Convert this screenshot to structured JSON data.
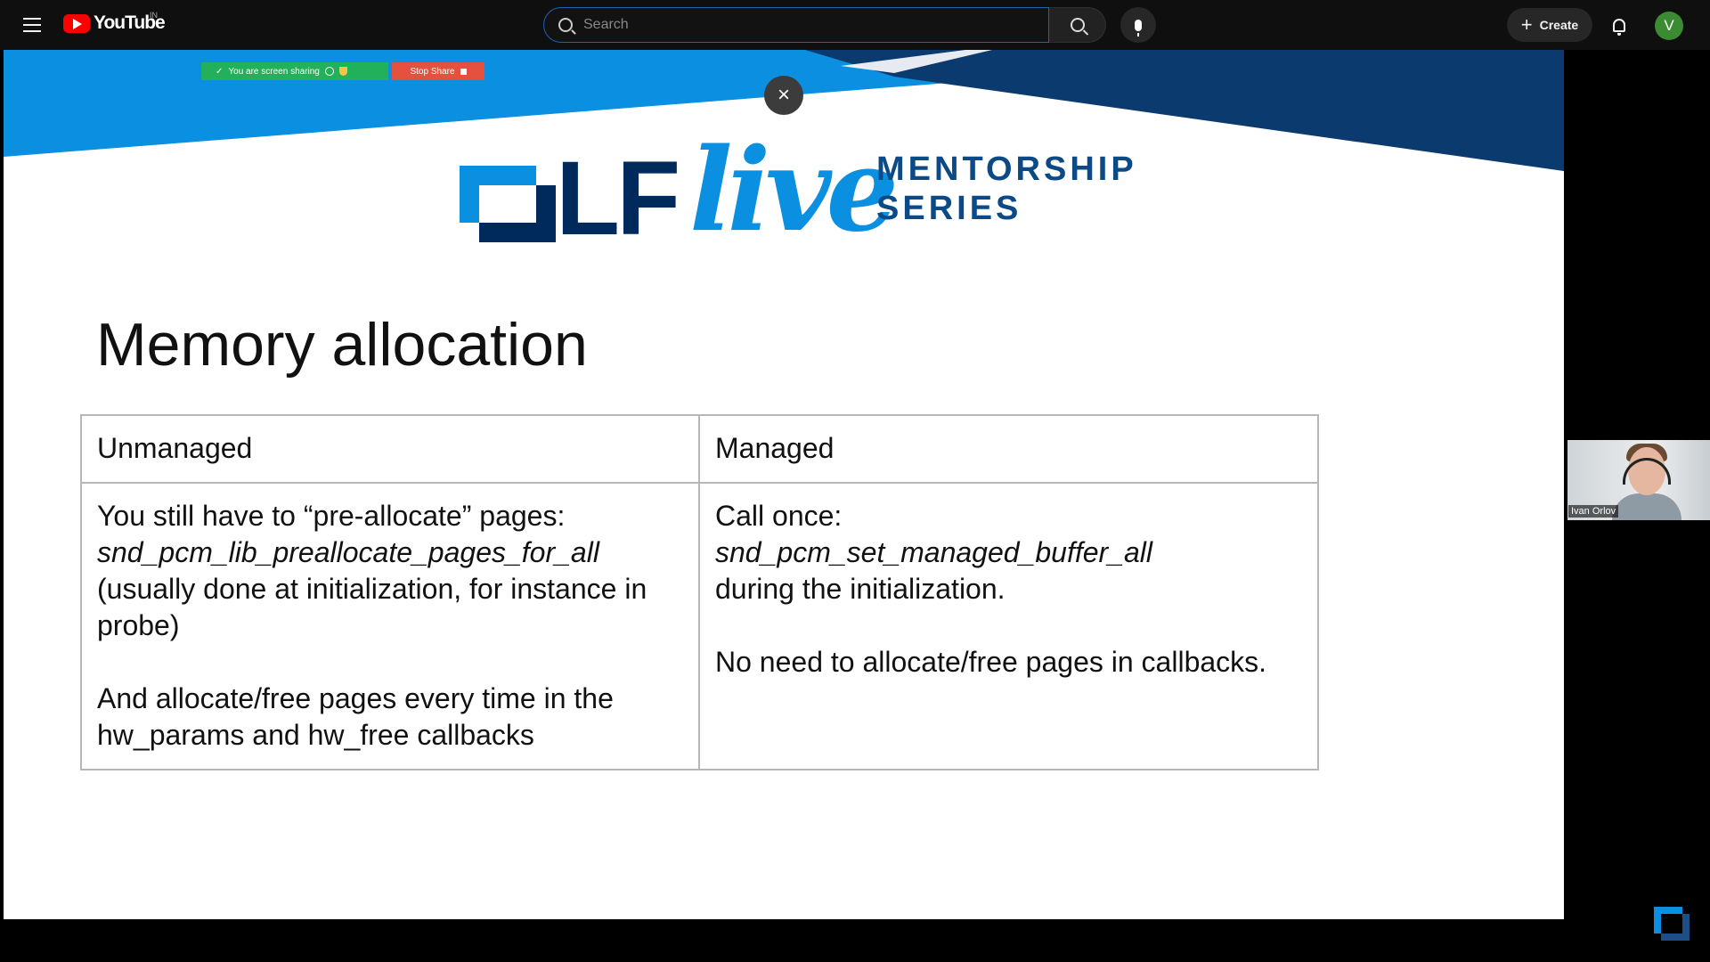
{
  "topbar": {
    "brand": "YouTube",
    "country": "IN",
    "search_placeholder": "Search",
    "create_label": "Create",
    "avatar_initial": "V"
  },
  "slide": {
    "share_status": "You are screen sharing",
    "stop_share": "Stop Share",
    "close_glyph": "×",
    "logo_text": "LF",
    "logo_live": "live",
    "series_line1": "MENTORSHIP",
    "series_line2": "SERIES",
    "title": "Memory allocation",
    "table": {
      "headers": [
        "Unmanaged",
        "Managed"
      ],
      "unmanaged": {
        "line1": "You still have to “pre-allocate” pages:",
        "func": "snd_pcm_lib_preallocate_pages_for_all",
        "line2": "(usually done at initialization, for instance in probe)",
        "line3": "And allocate/free pages every time in the hw_params and hw_free callbacks"
      },
      "managed": {
        "line1": "Call once:",
        "func": "snd_pcm_set_managed_buffer_all",
        "line2": "during the initialization.",
        "line3": "No need to allocate/free pages in callbacks."
      }
    }
  },
  "webcam": {
    "participant_name": "Ivan Orlov"
  },
  "colors": {
    "banner_dark": "#0a3a6e",
    "banner_light": "#0b8fe0",
    "share_green": "#23b05a",
    "stop_red": "#e4523f"
  }
}
